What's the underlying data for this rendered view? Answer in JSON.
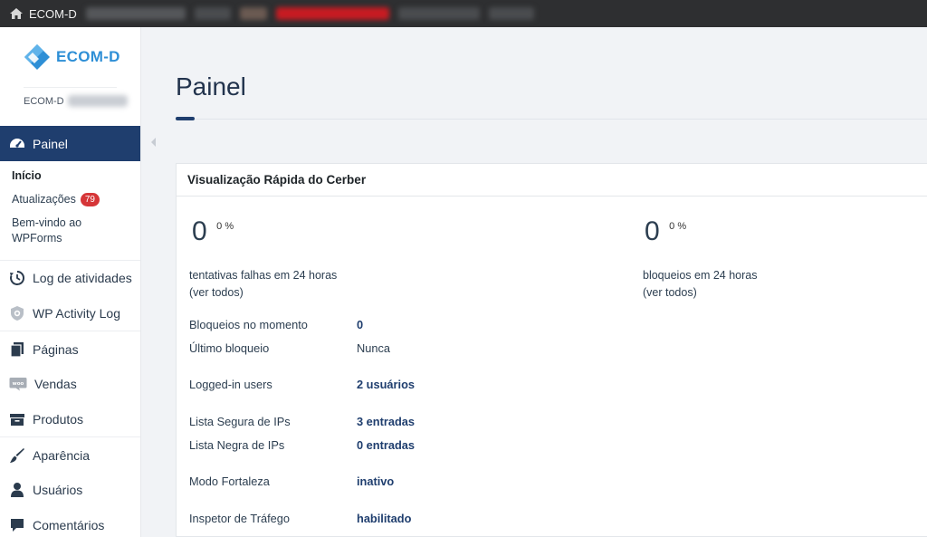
{
  "adminbar": {
    "site_name": "ECOM-D"
  },
  "brand": {
    "logo_text": "ECOM-D",
    "site_label": "ECOM-D",
    "accent": "#2e8fd6"
  },
  "sidebar": {
    "active": {
      "label": "Painel",
      "icon": "dashboard-icon"
    },
    "submenu": [
      {
        "label": "Início"
      },
      {
        "label": "Atualizações",
        "badge": "79"
      },
      {
        "label": "Bem-vindo ao WPForms"
      }
    ],
    "items": [
      {
        "label": "Log de atividades",
        "icon": "history-icon"
      },
      {
        "label": "WP Activity Log",
        "icon": "shield-icon"
      },
      {
        "label": "Páginas",
        "icon": "pages-icon"
      },
      {
        "label": "Vendas",
        "icon": "woo-icon"
      },
      {
        "label": "Produtos",
        "icon": "archive-icon"
      },
      {
        "label": "Aparência",
        "icon": "brush-icon"
      },
      {
        "label": "Usuários",
        "icon": "user-icon"
      },
      {
        "label": "Comentários",
        "icon": "comment-icon"
      }
    ]
  },
  "main": {
    "title": "Painel",
    "card": {
      "title": "Visualização Rápida do Cerber",
      "stats": [
        {
          "value": "0",
          "pct": "0 %",
          "label": "tentativas falhas em 24 horas",
          "link": "(ver todos)"
        },
        {
          "value": "0",
          "pct": "0 %",
          "label": "bloqueios em 24 horas",
          "link": "(ver todos)"
        }
      ],
      "rows": [
        {
          "label": "Bloqueios no momento",
          "value": "0"
        },
        {
          "label": "Último bloqueio",
          "value": "Nunca"
        },
        {
          "label": "Logged-in users",
          "value": "2 usuários"
        },
        {
          "label": "Lista Segura de IPs",
          "value": "3 entradas"
        },
        {
          "label": "Lista Negra de IPs",
          "value": "0 entradas"
        },
        {
          "label": "Modo Fortaleza",
          "value": "inativo"
        },
        {
          "label": "Inspetor de Tráfego",
          "value": "habilitado"
        }
      ]
    }
  },
  "colors": {
    "sidebar_active_bg": "#1f3e6e",
    "badge": "#d63638",
    "adminbar": "#2e2f31"
  }
}
